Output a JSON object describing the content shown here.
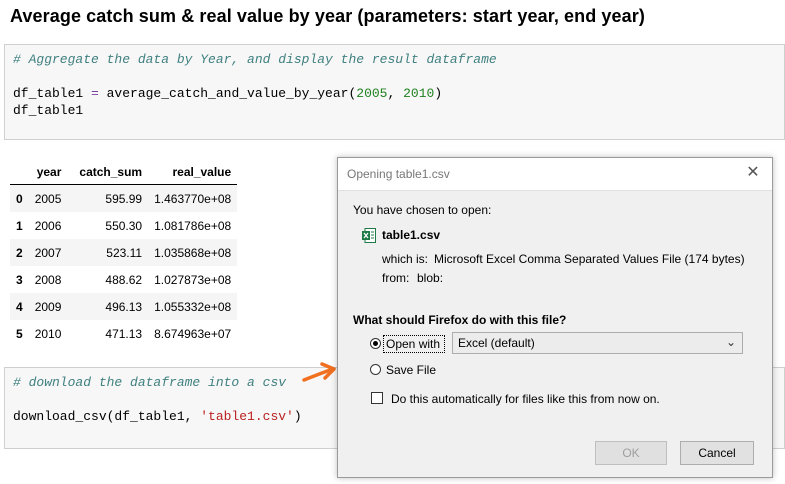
{
  "heading": "Average catch sum & real value by year (parameters: start year, end year)",
  "cell1": {
    "comment": "# Aggregate the data by Year, and display the result dataframe",
    "line2_var": "df_table1",
    "line2_op": " = ",
    "line2_func": "average_catch_and_value_by_year(",
    "line2_arg1": "2005",
    "line2_sep": ", ",
    "line2_arg2": "2010",
    "line2_close": ")",
    "line3": "df_table1"
  },
  "table": {
    "columns": [
      "",
      "year",
      "catch_sum",
      "real_value"
    ],
    "rows": [
      {
        "idx": "0",
        "year": "2005",
        "catch_sum": "595.99",
        "real_value": "1.463770e+08"
      },
      {
        "idx": "1",
        "year": "2006",
        "catch_sum": "550.30",
        "real_value": "1.081786e+08"
      },
      {
        "idx": "2",
        "year": "2007",
        "catch_sum": "523.11",
        "real_value": "1.035868e+08"
      },
      {
        "idx": "3",
        "year": "2008",
        "catch_sum": "488.62",
        "real_value": "1.027873e+08"
      },
      {
        "idx": "4",
        "year": "2009",
        "catch_sum": "496.13",
        "real_value": "1.055332e+08"
      },
      {
        "idx": "5",
        "year": "2010",
        "catch_sum": "471.13",
        "real_value": "8.674963e+07"
      }
    ]
  },
  "cell2": {
    "comment": "# download the dataframe into a csv",
    "func": "download_csv(df_table1, ",
    "str": "'table1.csv'",
    "close": ")"
  },
  "dialog": {
    "title": "Opening table1.csv",
    "chosen_text": "You have chosen to open:",
    "filename": "table1.csv",
    "which_is_label": "which is:",
    "which_is_value": "Microsoft Excel Comma Separated Values File (174 bytes)",
    "from_label": "from:",
    "from_value": "blob:",
    "question": "What should Firefox do with this file?",
    "open_with_label": "Open with",
    "open_with_value": "Excel (default)",
    "save_file_label": "Save File",
    "auto_label": "Do this automatically for files like this from now on.",
    "ok_label": "OK",
    "cancel_label": "Cancel",
    "close_glyph": "✕",
    "selected_option": "open_with",
    "auto_checked": false
  },
  "colors": {
    "comment": "#408080",
    "number": "#208020",
    "string": "#ba2121",
    "operator": "#7a3ea0",
    "arrow": "#f07020",
    "excel_green": "#1d7a45"
  },
  "icons": [
    "close-icon",
    "excel-file-icon",
    "chevron-down-icon",
    "arrow-annotation-icon"
  ]
}
